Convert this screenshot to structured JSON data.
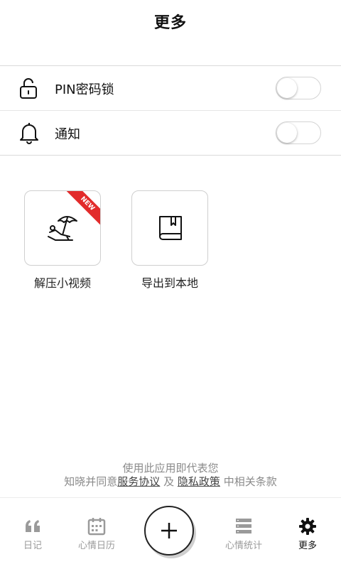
{
  "header": {
    "title": "更多"
  },
  "settings": [
    {
      "label": "PIN密码锁",
      "icon": "unlock-icon",
      "enabled": false
    },
    {
      "label": "通知",
      "icon": "bell-icon",
      "enabled": false
    }
  ],
  "features": [
    {
      "label": "解压小视频",
      "icon": "beach-umbrella-icon",
      "badge": "NEW"
    },
    {
      "label": "导出到本地",
      "icon": "book-icon"
    }
  ],
  "footer": {
    "line1": "使用此应用即代表您",
    "line2_prefix": "知晓并同意",
    "terms_link": "服务协议",
    "and": "及",
    "privacy_link": "隐私政策",
    "line2_suffix": "中相关条款"
  },
  "tabbar": {
    "items": [
      {
        "label": "日记",
        "icon": "quote-icon"
      },
      {
        "label": "心情日历",
        "icon": "calendar-icon"
      },
      {
        "label": "",
        "icon": "plus-icon"
      },
      {
        "label": "心情统计",
        "icon": "stats-list-icon"
      },
      {
        "label": "更多",
        "icon": "gear-icon"
      }
    ],
    "active": "更多"
  },
  "colors": {
    "badge": "#e22b2b",
    "active_tab": "#111111",
    "inactive_tab": "#9a9a9a"
  }
}
